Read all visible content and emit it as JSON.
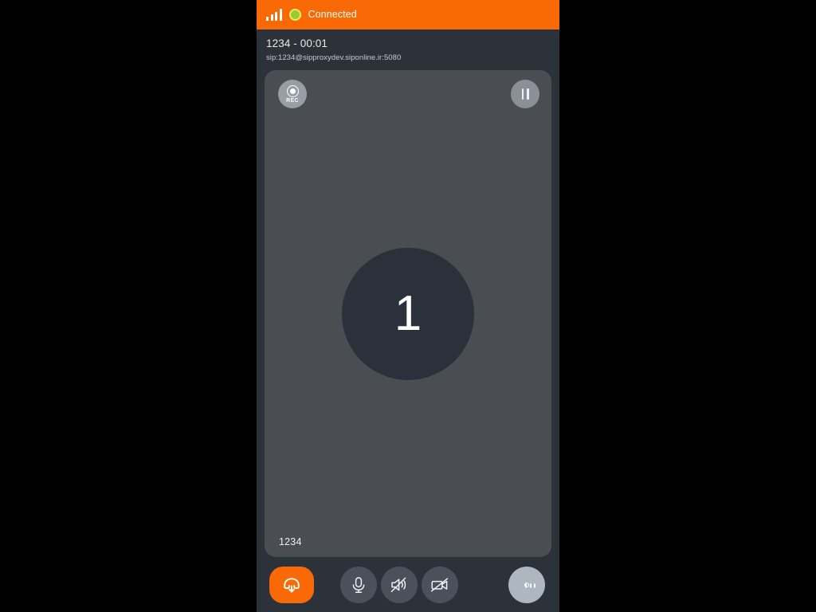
{
  "app": {
    "background_color": "#000000",
    "frame_background": "#2b323a",
    "accent_color": "#f96a07"
  },
  "status_bar": {
    "background_color": "#f96a07",
    "signal_icon": "signal-bars-icon",
    "signal_bars": 4,
    "connection_indicator_color": "#9cc930",
    "connection_status": "Connected"
  },
  "call_header": {
    "title": "1234 - 00:01",
    "uri": "sip:1234@sipproxydev.siponline.ir:5080"
  },
  "video_stage": {
    "background_color": "#4a4d52",
    "record_button": {
      "label": "REC",
      "icon": "record-dot-icon"
    },
    "pause_button": {
      "icon": "pause-icon"
    },
    "remote_avatar": {
      "initial": "1",
      "background_color": "#2a313a"
    },
    "participant_name": "1234"
  },
  "control_bar": {
    "buttons": [
      {
        "name": "hangup",
        "icon": "phone-hangup-icon",
        "label": "Hang up",
        "color": "#f96a07"
      },
      {
        "name": "microphone",
        "icon": "microphone-icon",
        "label": "Microphone",
        "color": "#4a515a"
      },
      {
        "name": "speaker",
        "icon": "speaker-muted-icon",
        "label": "Speaker muted",
        "color": "#4a515a"
      },
      {
        "name": "camera",
        "icon": "camera-off-icon",
        "label": "Camera off",
        "color": "#4a515a"
      },
      {
        "name": "more-options",
        "icon": "three-dots-icon",
        "label": "More options",
        "color": "#aeb6bf"
      }
    ]
  }
}
